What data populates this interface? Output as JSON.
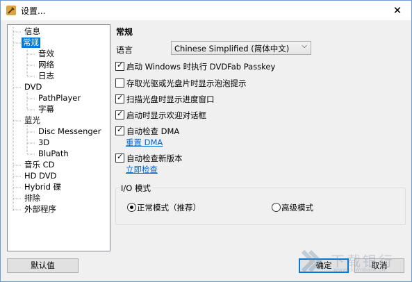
{
  "window": {
    "title": "设置...",
    "close_glyph": "✕"
  },
  "tree": {
    "items": [
      {
        "label": "信息",
        "level": 1
      },
      {
        "label": "常规",
        "level": 1,
        "selected": true
      },
      {
        "label": "音效",
        "level": 2
      },
      {
        "label": "网络",
        "level": 2
      },
      {
        "label": "日志",
        "level": 2
      },
      {
        "label": "DVD",
        "level": 1
      },
      {
        "label": "PathPlayer",
        "level": 2
      },
      {
        "label": "字幕",
        "level": 2
      },
      {
        "label": "蓝光",
        "level": 1
      },
      {
        "label": "Disc Messenger",
        "level": 2
      },
      {
        "label": "3D",
        "level": 2
      },
      {
        "label": "BluPath",
        "level": 2
      },
      {
        "label": "音乐 CD",
        "level": 1
      },
      {
        "label": "HD DVD",
        "level": 1
      },
      {
        "label": "Hybrid 碟",
        "level": 1
      },
      {
        "label": "排除",
        "level": 1
      },
      {
        "label": "外部程序",
        "level": 1
      }
    ]
  },
  "general": {
    "title": "常规",
    "language_label": "语言",
    "language_value": "Chinese Simplified (简体中文)",
    "checkboxes": [
      {
        "label": "启动 Windows 时执行 DVDFab Passkey",
        "checked": true
      },
      {
        "label": "存取光驱或光盘片时显示泡泡提示",
        "checked": false
      },
      {
        "label": "扫描光盘时显示进度窗口",
        "checked": true
      },
      {
        "label": "启动时显示欢迎对话框",
        "checked": true
      },
      {
        "label": "自动检查 DMA",
        "checked": true
      },
      {
        "label": "自动检查新版本",
        "checked": true
      }
    ],
    "reset_dma_link": "重置 DMA",
    "check_now_link": "立即检查",
    "io_mode": {
      "title": "I/O 模式",
      "normal_label": "正常模式（推荐）",
      "advanced_label": "高级模式",
      "selected": "normal"
    }
  },
  "buttons": {
    "default": "默认值",
    "ok": "确定",
    "cancel": "取消"
  },
  "watermark": {
    "text": "下载银行",
    "url": "www.downbank.cn"
  },
  "colors": {
    "selection": "#0078d7",
    "link": "#0066cc"
  }
}
